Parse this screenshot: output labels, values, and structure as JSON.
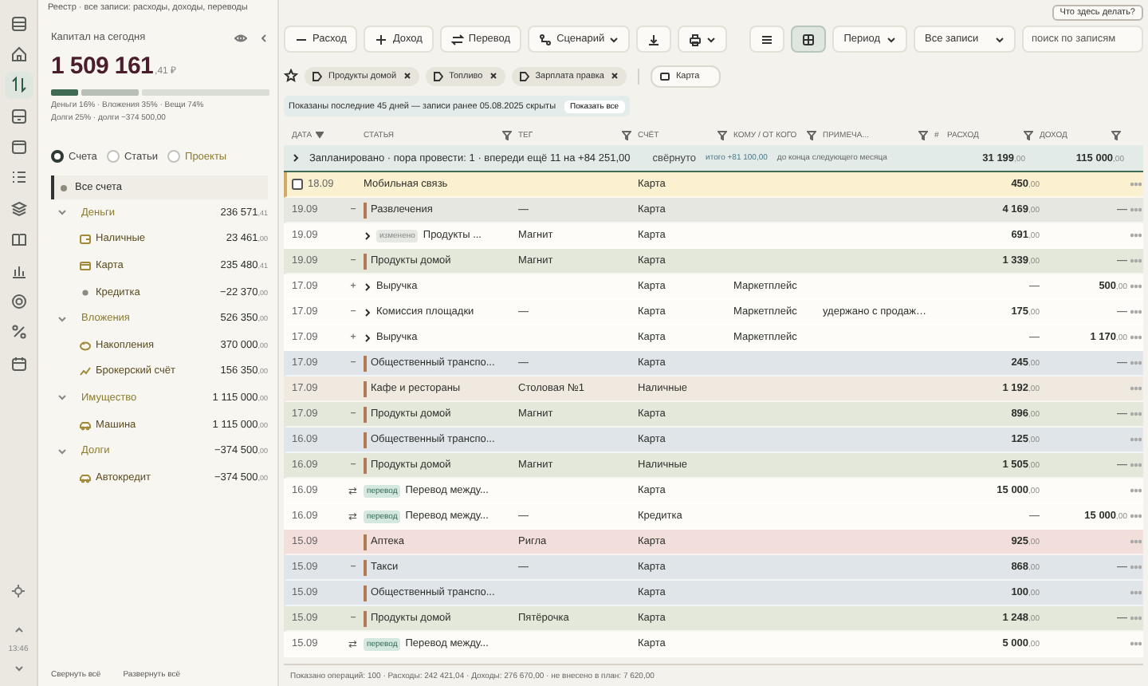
{
  "header": {
    "title": "Реестр · все записи: расходы, доходы, переводы",
    "help_button": "Что здесь делать?"
  },
  "rail": {
    "items": [
      {
        "selected": false
      },
      {
        "selected": false
      },
      {
        "selected": true
      },
      {
        "selected": false
      },
      {
        "selected": false
      },
      {
        "selected": false
      },
      {
        "selected": false
      },
      {
        "selected": false
      },
      {
        "selected": false
      },
      {
        "selected": false
      },
      {
        "selected": false
      },
      {
        "selected": false
      }
    ],
    "time": "13:46"
  },
  "capital": {
    "label": "Капитал на сегодня",
    "amount": "1 509 161",
    "cents": ",41 ₽",
    "legend": [
      "Деньги 16% · Вложения 35% · Вещи 74%",
      "Долги 25% · долги −374 500,00"
    ]
  },
  "views": [
    {
      "label": "Счета",
      "selected": true
    },
    {
      "label": "Статьи",
      "selected": false
    },
    {
      "label": "Проекты",
      "selected": false
    }
  ],
  "accounts": {
    "all": {
      "label": "Все счета",
      "selected": true
    },
    "groups": [
      {
        "label": "Деньги",
        "amount": "236 571,41",
        "expanded": true,
        "selected": false,
        "children": [
          {
            "label": "Наличные",
            "kind": "cash",
            "amount": "23 461,00",
            "selected": false
          },
          {
            "label": "Карта",
            "kind": "card",
            "amount": "235 480,41",
            "selected": false
          },
          {
            "label": "Кредитка",
            "kind": "dot",
            "amount": "−22 370,00",
            "selected": false
          }
        ]
      },
      {
        "label": "Вложения",
        "amount": "526 350,00",
        "expanded": true,
        "selected": false,
        "children": [
          {
            "label": "Накопления",
            "kind": "savings",
            "amount": "370 000,00",
            "selected": false
          },
          {
            "label": "Брокерский счёт",
            "kind": "broker",
            "amount": "156 350,00",
            "selected": false
          }
        ]
      },
      {
        "label": "Имущество",
        "amount": "1 115 000,00",
        "expanded": true,
        "selected": false,
        "children": [
          {
            "label": "Машина",
            "kind": "car",
            "amount": "1 115 000,00",
            "selected": false
          }
        ]
      },
      {
        "label": "Долги",
        "amount": "−374 500,00",
        "expanded": true,
        "selected": false,
        "children": [
          {
            "label": "Автокредит",
            "kind": "car",
            "amount": "−374 500,00",
            "selected": false
          }
        ]
      }
    ]
  },
  "tree_actions": [
    "Свернуть всё",
    "Развернуть всё"
  ],
  "toolbar": {
    "actions": [
      {
        "kind": "expense",
        "label": "Расход"
      },
      {
        "kind": "income",
        "label": "Доход"
      },
      {
        "kind": "transfer",
        "label": "Перевод"
      },
      {
        "kind": "scenario",
        "label": "Сценарий"
      }
    ],
    "views": [
      {
        "selected": false
      },
      {
        "selected": true
      }
    ],
    "period": "Период",
    "filter": "Все записи",
    "search": {
      "placeholder": "поиск по записям"
    }
  },
  "filters": {
    "chips": [
      {
        "label": "Продукты домой"
      },
      {
        "label": "Топливо"
      },
      {
        "label": "Зарплата правка"
      }
    ],
    "account": "Карта"
  },
  "notice": {
    "text": "Показаны последние 45 дней — записи ранее 05.08.2025 скрыты",
    "button": "Показать все"
  },
  "table": {
    "columns": [
      {
        "label": "ДАТА",
        "kind": "sort"
      },
      {
        "label": "СТАТЬЯ",
        "kind": "filter"
      },
      {
        "label": "ТЕГ",
        "kind": "filter"
      },
      {
        "label": "СЧЁТ",
        "kind": "filter"
      },
      {
        "label": "КОМУ / ОТ КОГО",
        "kind": "filter"
      },
      {
        "label": "ПРИМЕЧА...",
        "kind": "filter"
      },
      {
        "label": "#",
        "kind": "plain"
      },
      {
        "label": "РАСХОД",
        "kind": "filter"
      },
      {
        "label": "ДОХОД",
        "kind": "filter"
      }
    ],
    "planned": {
      "text": "Запланировано · пора провести: 1 · впереди ещё 11 на +84 251,00",
      "state": "свёрнуто",
      "total": "итого +81 100,00",
      "period": "до конца следующего месяца",
      "expense": "31 199,00",
      "income": "115 000,00"
    },
    "rows": [
      {
        "date": "18.09",
        "sign": "",
        "kind": "plain",
        "category": "Мобильная связь",
        "tag": "",
        "account": "Карта",
        "who": "",
        "note": "",
        "expense": "450,00",
        "income": "",
        "color": "#fbf0cf",
        "hovered": true
      },
      {
        "date": "19.09",
        "sign": "−",
        "kind": "plain",
        "category": "Развлечения",
        "tag": "—",
        "account": "Карта",
        "who": "",
        "note": "",
        "expense": "4 169,00",
        "income": "—",
        "color": "#e5e7e0",
        "hovered": false
      },
      {
        "date": "19.09",
        "sign": "",
        "kind": "split",
        "badge": "изменено",
        "category": "Продукты ...",
        "tag": "Магнит",
        "account": "Карта",
        "who": "",
        "note": "",
        "expense": "691,00",
        "income": "",
        "color": "#fdfcf9",
        "hovered": false
      },
      {
        "date": "19.09",
        "sign": "−",
        "kind": "plain",
        "category": "Продукты домой",
        "tag": "Магнит",
        "account": "Карта",
        "who": "",
        "note": "",
        "expense": "1 339,00",
        "income": "—",
        "color": "#e3e8da",
        "hovered": false
      },
      {
        "date": "17.09",
        "sign": "+",
        "kind": "split",
        "category": "Выручка",
        "tag": "",
        "account": "Карта",
        "who": "Маркетплейс",
        "note": "",
        "expense": "—",
        "income": "500,00",
        "color": "#fdfcf9",
        "hovered": false
      },
      {
        "date": "17.09",
        "sign": "−",
        "kind": "split",
        "category": "Комиссия площадки",
        "tag": "—",
        "account": "Карта",
        "who": "Маркетплейс",
        "note": "удержано с продаж…",
        "expense": "175,00",
        "income": "—",
        "color": "#fdfcf9",
        "hovered": false
      },
      {
        "date": "17.09",
        "sign": "+",
        "kind": "split",
        "category": "Выручка",
        "tag": "",
        "account": "Карта",
        "who": "Маркетплейс",
        "note": "",
        "expense": "—",
        "income": "1 170,00",
        "color": "#fdfcf9",
        "hovered": false
      },
      {
        "date": "17.09",
        "sign": "−",
        "kind": "plain",
        "category": "Общественный транспо...",
        "tag": "—",
        "account": "Карта",
        "who": "",
        "note": "",
        "expense": "245,00",
        "income": "—",
        "color": "#dfe5e8",
        "hovered": false
      },
      {
        "date": "17.09",
        "sign": "",
        "kind": "plain",
        "category": "Кафе и рестораны",
        "tag": "Столовая №1",
        "account": "Наличные",
        "who": "",
        "note": "",
        "expense": "1 192,00",
        "income": "",
        "color": "#efe9df",
        "hovered": false
      },
      {
        "date": "17.09",
        "sign": "−",
        "kind": "plain",
        "category": "Продукты домой",
        "tag": "Магнит",
        "account": "Карта",
        "who": "",
        "note": "",
        "expense": "896,00",
        "income": "—",
        "color": "#e3e8da",
        "hovered": false
      },
      {
        "date": "16.09",
        "sign": "",
        "kind": "plain",
        "category": "Общественный транспо...",
        "tag": "",
        "account": "Карта",
        "who": "",
        "note": "",
        "expense": "125,00",
        "income": "",
        "color": "#dfe5e8",
        "hovered": false
      },
      {
        "date": "16.09",
        "sign": "−",
        "kind": "plain",
        "category": "Продукты домой",
        "tag": "Магнит",
        "account": "Наличные",
        "who": "",
        "note": "",
        "expense": "1 505,00",
        "income": "—",
        "color": "#e3e8da",
        "hovered": false
      },
      {
        "date": "16.09",
        "sign": "⇄",
        "kind": "transfer",
        "badge": "перевод",
        "category": "Перевод между...",
        "tag": "",
        "account": "Карта",
        "who": "",
        "note": "",
        "expense": "15 000,00",
        "income": "",
        "color": "#fdfcf9",
        "hovered": false
      },
      {
        "date": "16.09",
        "sign": "⇄",
        "kind": "transfer",
        "badge": "перевод",
        "category": "Перевод между...",
        "tag": "—",
        "account": "Кредитка",
        "who": "",
        "note": "",
        "expense": "—",
        "income": "15 000,00",
        "color": "#fdfcf9",
        "hovered": false
      },
      {
        "date": "15.09",
        "sign": "",
        "kind": "plain",
        "category": "Аптека",
        "tag": "Ригла",
        "account": "Карта",
        "who": "",
        "note": "",
        "expense": "925,00",
        "income": "",
        "color": "#f2dfdc",
        "hovered": false
      },
      {
        "date": "15.09",
        "sign": "−",
        "kind": "plain",
        "category": "Такси",
        "tag": "—",
        "account": "Карта",
        "who": "",
        "note": "",
        "expense": "868,00",
        "income": "—",
        "color": "#dfe5e8",
        "hovered": false
      },
      {
        "date": "15.09",
        "sign": "",
        "kind": "plain",
        "category": "Общественный транспо...",
        "tag": "",
        "account": "Карта",
        "who": "",
        "note": "",
        "expense": "100,00",
        "income": "",
        "color": "#dfe5e8",
        "hovered": false
      },
      {
        "date": "15.09",
        "sign": "−",
        "kind": "plain",
        "category": "Продукты домой",
        "tag": "Пятёрочка",
        "account": "Карта",
        "who": "",
        "note": "",
        "expense": "1 248,00",
        "income": "—",
        "color": "#e3e8da",
        "hovered": false
      },
      {
        "date": "15.09",
        "sign": "⇄",
        "kind": "transfer",
        "badge": "перевод",
        "category": "Перевод между...",
        "tag": "",
        "account": "Карта",
        "who": "",
        "note": "",
        "expense": "5 000,00",
        "income": "",
        "color": "#fdfcf9",
        "hovered": false
      }
    ],
    "footer": "Показано операций: 100 · Расходы: 242 421,04 · Доходы: 276 670,00 · не внесено в план: 7 620,00"
  }
}
